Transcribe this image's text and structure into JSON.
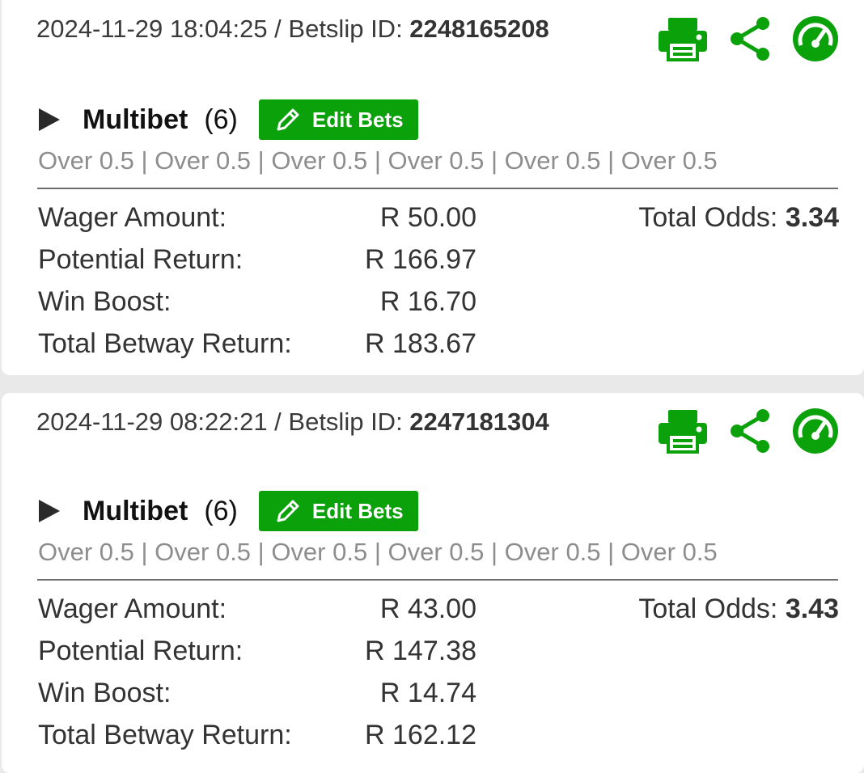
{
  "colors": {
    "brand_green": "#0aa10a",
    "background": "#e9e9e9"
  },
  "betslips": [
    {
      "datetime": "2024-11-29 18:04:25",
      "separator": " / ",
      "id_label": "Betslip ID: ",
      "id": "2248165208",
      "icons": [
        "printer-icon",
        "share-icon",
        "speedometer-icon"
      ],
      "bet_type": "Multibet",
      "bet_count": "(6)",
      "edit_label": "Edit Bets",
      "selections": "Over 0.5 | Over 0.5 | Over 0.5 | Over 0.5 | Over 0.5 | Over 0.5",
      "total_odds_label": "Total Odds: ",
      "total_odds": "3.34",
      "rows": [
        {
          "label": "Wager Amount:",
          "value": "R 50.00"
        },
        {
          "label": "Potential Return:",
          "value": "R 166.97"
        },
        {
          "label": "Win Boost:",
          "value": "R 16.70"
        },
        {
          "label": "Total Betway Return:",
          "value": "R 183.67"
        }
      ]
    },
    {
      "datetime": "2024-11-29 08:22:21",
      "separator": " / ",
      "id_label": "Betslip ID: ",
      "id": "2247181304",
      "icons": [
        "printer-icon",
        "share-icon",
        "speedometer-icon"
      ],
      "bet_type": "Multibet",
      "bet_count": "(6)",
      "edit_label": "Edit Bets",
      "selections": "Over 0.5 | Over 0.5 | Over 0.5 | Over 0.5 | Over 0.5 | Over 0.5",
      "total_odds_label": "Total Odds: ",
      "total_odds": "3.43",
      "rows": [
        {
          "label": "Wager Amount:",
          "value": "R 43.00"
        },
        {
          "label": "Potential Return:",
          "value": "R 147.38"
        },
        {
          "label": "Win Boost:",
          "value": "R 14.74"
        },
        {
          "label": "Total Betway Return:",
          "value": "R 162.12"
        }
      ]
    }
  ]
}
